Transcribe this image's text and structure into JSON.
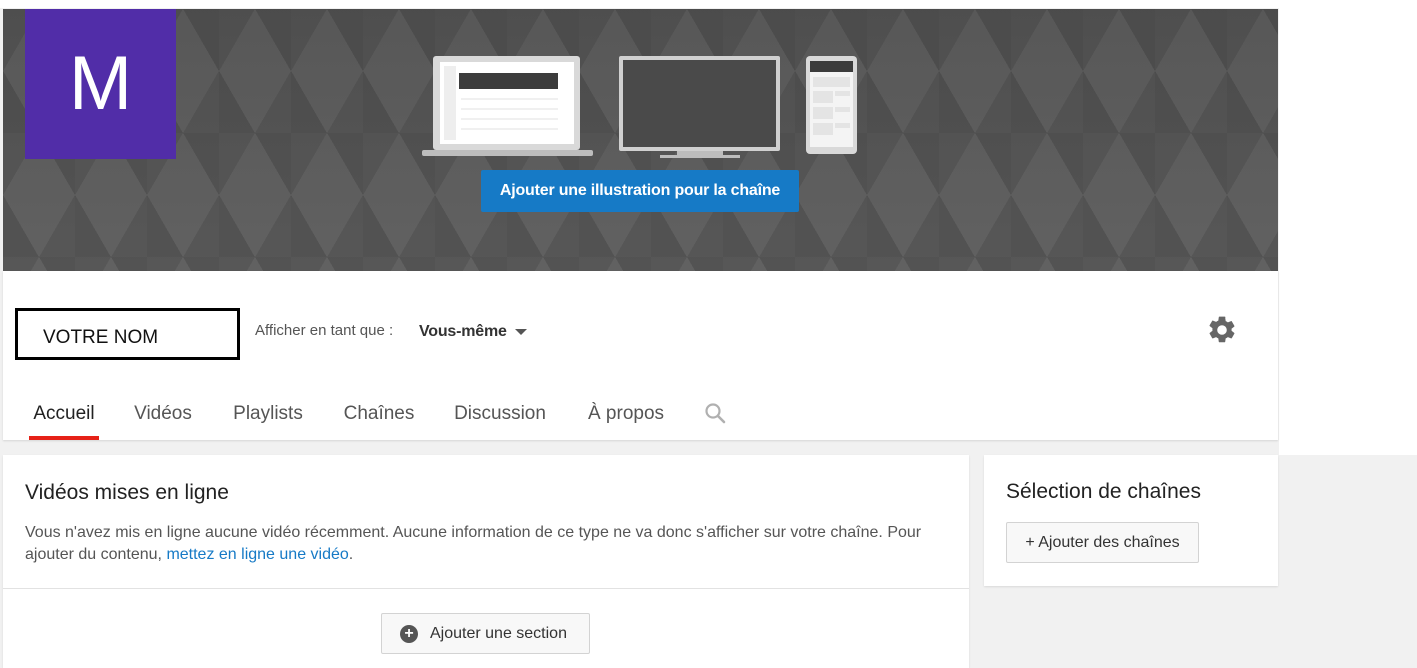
{
  "banner": {
    "avatar_letter": "M",
    "avatar_color": "#512da8",
    "cta_label": "Ajouter une illustration pour la chaîne",
    "cta_color": "#167ac6"
  },
  "header": {
    "channel_name": "VOTRE NOM",
    "view_as_label": "Afficher en tant que :",
    "view_as_value": "Vous-même",
    "settings_icon": "gear-icon"
  },
  "tabs": [
    {
      "label": "Accueil",
      "active": true
    },
    {
      "label": "Vidéos",
      "active": false
    },
    {
      "label": "Playlists",
      "active": false
    },
    {
      "label": "Chaînes",
      "active": false
    },
    {
      "label": "Discussion",
      "active": false
    },
    {
      "label": "À propos",
      "active": false
    }
  ],
  "accent_color": "#e62117",
  "main": {
    "title": "Vidéos mises en ligne",
    "text_before": "Vous n'avez mis en ligne aucune vidéo récemment. Aucune information de ce type ne va donc s'afficher sur votre chaîne. Pour ajouter du contenu, ",
    "link_text": "mettez en ligne une vidéo",
    "text_after": ".",
    "add_section_label": "Ajouter une section"
  },
  "sidebar": {
    "title": "Sélection de chaînes",
    "add_channels_label": "+ Ajouter des chaînes"
  }
}
